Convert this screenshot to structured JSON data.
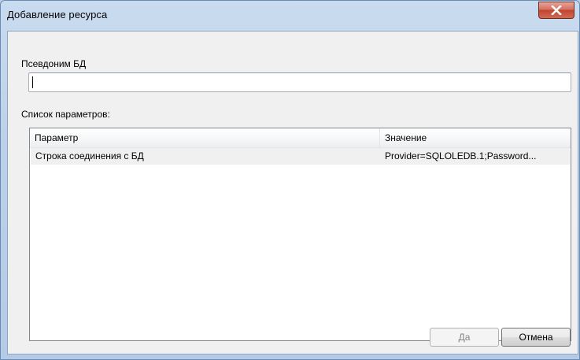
{
  "window": {
    "title": "Добавление ресурса"
  },
  "form": {
    "alias_label": "Псевдоним БД",
    "alias_value": "",
    "params_label": "Список параметров:"
  },
  "params_table": {
    "columns": [
      "Параметр",
      "Значение"
    ],
    "rows": [
      {
        "name": "Строка соединения с БД",
        "value": "Provider=SQLOLEDB.1;Password..."
      }
    ]
  },
  "buttons": {
    "ok_label": "Да",
    "cancel_label": "Отмена"
  },
  "icons": {
    "close": "close-icon"
  },
  "colors": {
    "close_button": "#c24431",
    "client_background": "#f0f0f0",
    "frame": "#bcd1e9"
  }
}
